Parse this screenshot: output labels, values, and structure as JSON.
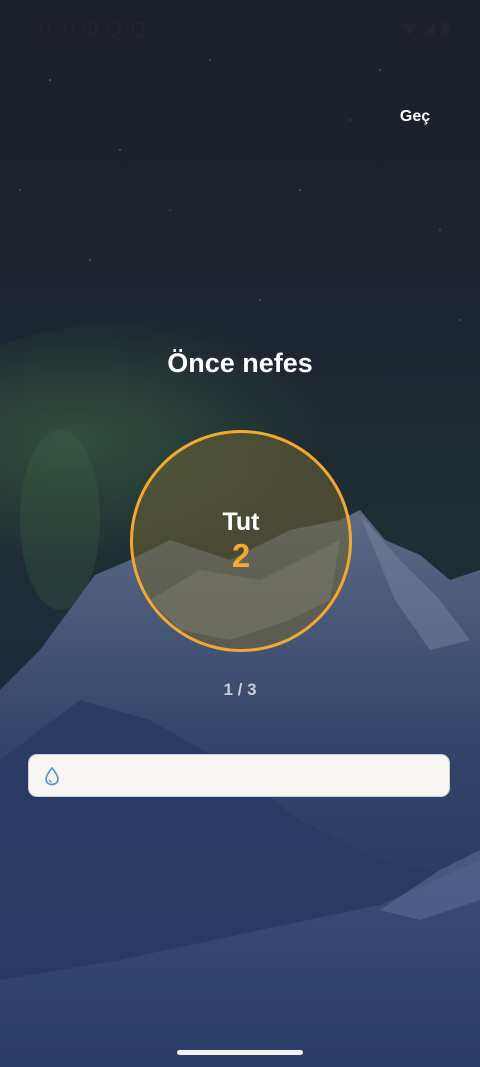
{
  "status_bar": {
    "time": "11:41",
    "left_icons": [
      "info-icon",
      "shield-icon",
      "clipboard-icon"
    ],
    "right_icons": [
      "wifi-icon",
      "signal-icon",
      "battery-icon"
    ]
  },
  "header": {
    "skip_label": "Geç"
  },
  "main": {
    "title": "Önce nefes",
    "phase_label": "Tut",
    "phase_count": "2",
    "cycle_counter": "1 / 3"
  },
  "input": {
    "value": "",
    "placeholder": "",
    "icon": "water-drop-icon"
  },
  "colors": {
    "accent": "#f2a92d",
    "circle_fill": "#6e6234",
    "background_dark": "#182233"
  }
}
